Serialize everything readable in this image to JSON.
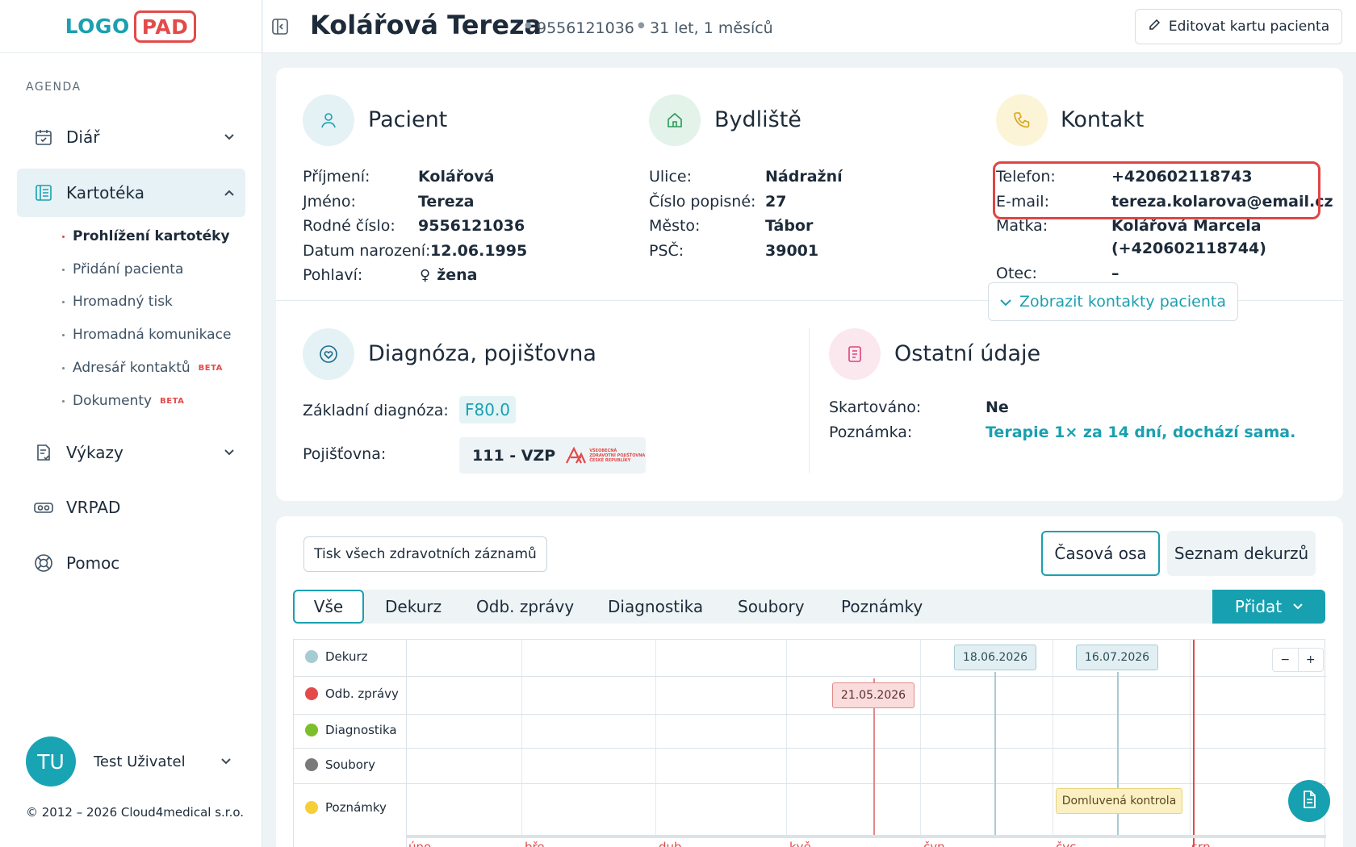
{
  "logo": {
    "part1": "LOGO",
    "part2": "PAD"
  },
  "sidebar": {
    "section": "AGENDA",
    "items": [
      {
        "label": "Diář",
        "icon": "calendar-icon"
      },
      {
        "label": "Kartotéka",
        "icon": "file-list-icon"
      },
      {
        "label": "Výkazy",
        "icon": "report-icon"
      },
      {
        "label": "VRPAD",
        "icon": "vr-headset-icon"
      },
      {
        "label": "Pomoc",
        "icon": "lifebuoy-icon"
      }
    ],
    "sub_items": [
      {
        "label": "Prohlížení kartotéky",
        "active": true
      },
      {
        "label": "Přidání pacienta"
      },
      {
        "label": "Hromadný tisk"
      },
      {
        "label": "Hromadná komunikace"
      },
      {
        "label": "Adresář kontaktů",
        "badge": "BETA"
      },
      {
        "label": "Dokumenty",
        "badge": "BETA"
      }
    ],
    "user": {
      "initials": "TU",
      "name": "Test Uživatel"
    },
    "copyright": "© 2012 – 2026 Cloud4medical s.r.o."
  },
  "header": {
    "name": "Kolářová Tereza",
    "birth_number": "9556121036",
    "age": "31 let, 1 měsíců",
    "edit_label": "Editovat kartu pacienta"
  },
  "patient": {
    "title": "Pacient",
    "fields": [
      {
        "label": "Příjmení:",
        "value": "Kolářová"
      },
      {
        "label": "Jméno:",
        "value": "Tereza"
      },
      {
        "label": "Rodné číslo:",
        "value": "9556121036"
      },
      {
        "label": "Datum narození:",
        "value": "12.06.1995"
      },
      {
        "label": "Pohlaví:",
        "value": "žena"
      }
    ]
  },
  "address": {
    "title": "Bydliště",
    "fields": [
      {
        "label": "Ulice:",
        "value": "Nádražní"
      },
      {
        "label": "Číslo popisné:",
        "value": "27"
      },
      {
        "label": "Město:",
        "value": "Tábor"
      },
      {
        "label": "PSČ:",
        "value": "39001"
      }
    ]
  },
  "contact": {
    "title": "Kontakt",
    "fields": [
      {
        "label": "Telefon:",
        "value": "+420602118743"
      },
      {
        "label": "E-mail:",
        "value": "tereza.kolarova@email.cz"
      },
      {
        "label": "Matka:",
        "value": "Kolářová Marcela",
        "value2": "(+420602118744)"
      },
      {
        "label": "Otec:",
        "value": "–"
      }
    ],
    "show_contacts": "Zobrazit kontakty pacienta"
  },
  "diagnosis": {
    "title": "Diagnóza, pojišťovna",
    "diag_label": "Základní diagnóza:",
    "diag_value": "F80.0",
    "ins_label": "Pojišťovna:",
    "ins_value": "111 - VZP",
    "ins_logo_text": [
      "VŠEOBECNÁ",
      "ZDRAVOTNÍ POJIŠŤOVNA",
      "ČESKÉ REPUBLIKY"
    ]
  },
  "other": {
    "title": "Ostatní údaje",
    "shred_label": "Skartováno:",
    "shred_value": "Ne",
    "note_label": "Poznámka:",
    "note_value": "Terapie 1× za 14 dní, dochází sama."
  },
  "records": {
    "print_label": "Tisk všech zdravotních záznamů",
    "view_timeline": "Časová osa",
    "view_list": "Seznam dekurzů",
    "tabs": [
      "Vše",
      "Dekurz",
      "Odb. zprávy",
      "Diagnostika",
      "Soubory",
      "Poznámky"
    ],
    "add_label": "Přidat"
  },
  "timeline": {
    "rows": [
      {
        "label": "Dekurz",
        "color": "#a6ccd3"
      },
      {
        "label": "Odb. zprávy",
        "color": "#e34a4a"
      },
      {
        "label": "Diagnostika",
        "color": "#7bbf2a"
      },
      {
        "label": "Soubory",
        "color": "#7a7a7a"
      },
      {
        "label": "Poznámky",
        "color": "#f5cf3a"
      }
    ],
    "events": [
      {
        "label": "18.06.2026",
        "type": "Dekurz"
      },
      {
        "label": "16.07.2026",
        "type": "Dekurz"
      },
      {
        "label": "21.05.2026",
        "type": "Odb. zprávy"
      },
      {
        "label": "Domluvená kontrola",
        "type": "Poznámky"
      }
    ],
    "months": [
      "úno",
      "bře",
      "dub",
      "kvě",
      "čvn",
      "čvc",
      "srp"
    ],
    "zoom_out": "−",
    "zoom_in": "+"
  }
}
